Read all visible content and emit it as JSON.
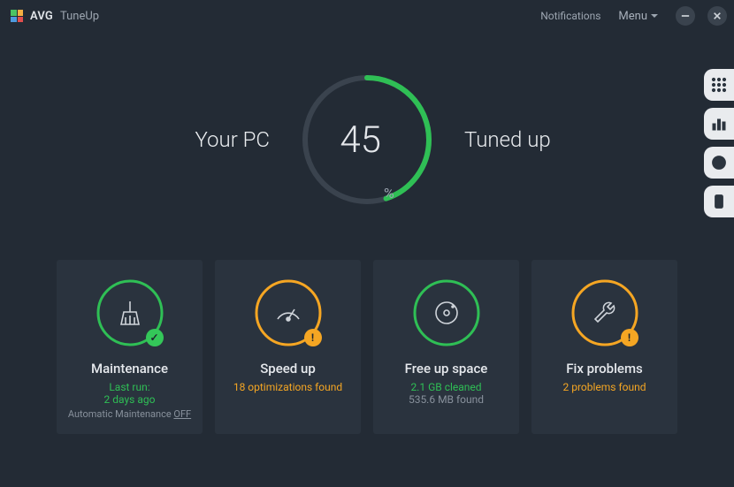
{
  "header": {
    "brand": "AVG",
    "product": "TuneUp",
    "notifications": "Notifications",
    "menu": "Menu"
  },
  "hero": {
    "left": "Your PC",
    "right": "Tuned up",
    "percent": "45",
    "percent_suffix": "%",
    "progress_fraction": 0.45
  },
  "tiles": {
    "maintenance": {
      "title": "Maintenance",
      "line1": "Last run:",
      "line2": "2 days ago",
      "line3_prefix": "Automatic Maintenance ",
      "line3_value": "OFF",
      "ring_color": "#2fbf55",
      "badge": "ok",
      "badge_glyph": "✓"
    },
    "speedup": {
      "title": "Speed up",
      "line1": "18 optimizations found",
      "ring_color": "#f5a623",
      "badge": "warn",
      "badge_glyph": "!"
    },
    "freespace": {
      "title": "Free up space",
      "line1": "2.1 GB cleaned",
      "line2": "535.6 MB found",
      "ring_color": "#2fbf55",
      "badge": "none"
    },
    "fix": {
      "title": "Fix problems",
      "line1": "2 problems found",
      "ring_color": "#f5a623",
      "badge": "warn",
      "badge_glyph": "!"
    }
  }
}
